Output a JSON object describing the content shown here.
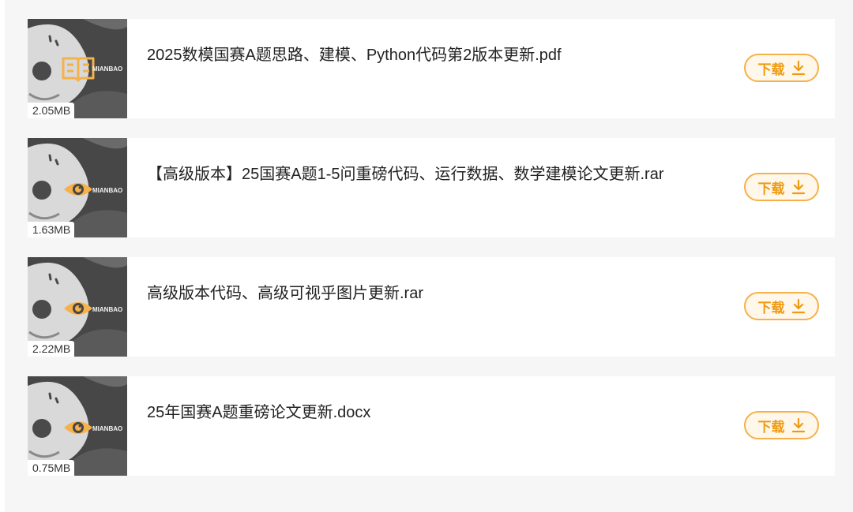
{
  "accent_color": "#f5b14a",
  "brand_mark": "MIANBAO",
  "download_label": "下载",
  "download_icon": "download-arrow-icon",
  "files": [
    {
      "size": "2.05MB",
      "name": "2025数模国赛A题思路、建模、Python代码第2版本更新.pdf",
      "type_icon": "book-icon"
    },
    {
      "size": "1.63MB",
      "name": "【高级版本】25国赛A题1-5问重磅代码、运行数据、数学建模论文更新.rar",
      "type_icon": "eye-icon"
    },
    {
      "size": "2.22MB",
      "name": "高级版本代码、高级可视乎图片更新.rar",
      "type_icon": "eye-icon"
    },
    {
      "size": "0.75MB",
      "name": "25年国赛A题重磅论文更新.docx",
      "type_icon": "eye-icon"
    }
  ]
}
